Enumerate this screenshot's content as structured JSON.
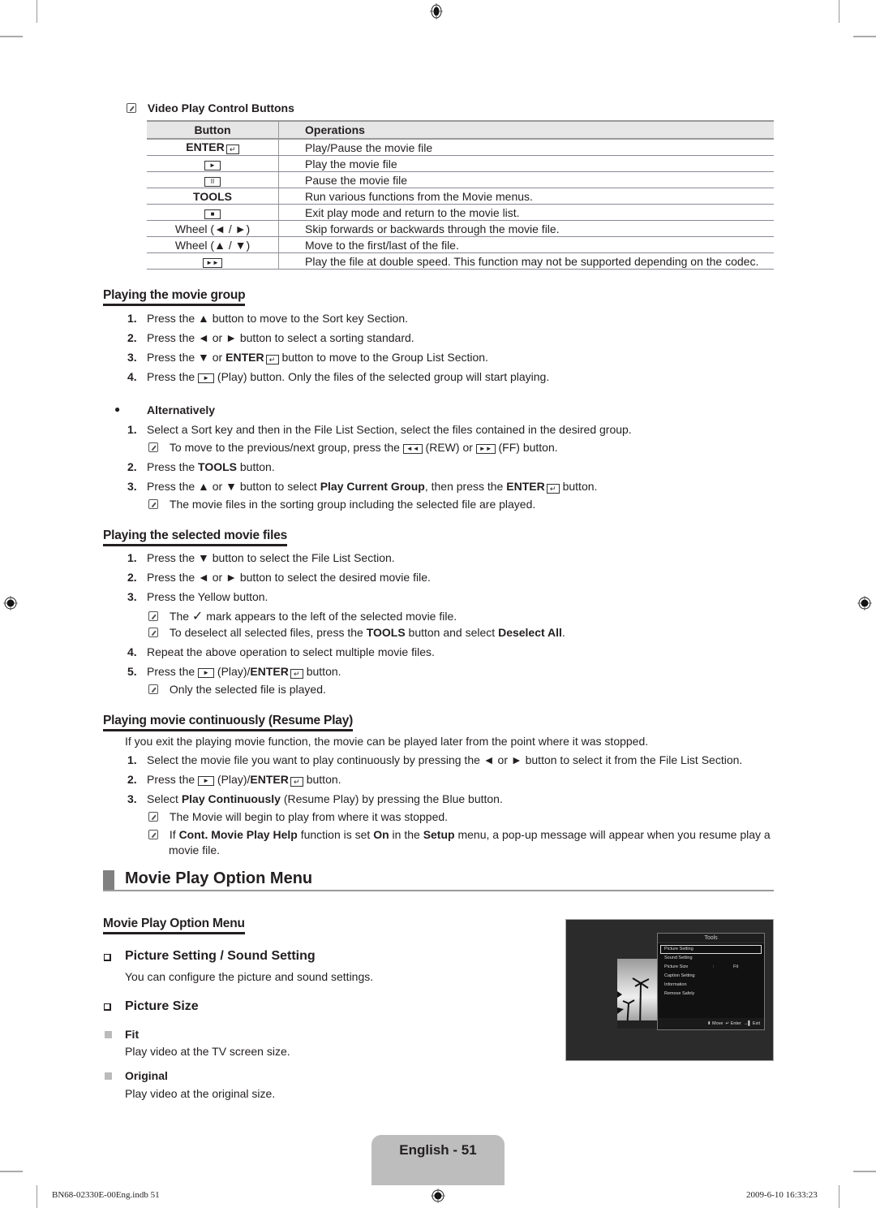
{
  "note_heading": "Video Play Control Buttons",
  "control_table": {
    "headers": [
      "Button",
      "Operations"
    ],
    "rows": [
      {
        "button": "ENTER",
        "button_type": "enter",
        "operation": "Play/Pause the movie file"
      },
      {
        "button": "►",
        "button_type": "box",
        "operation": "Play the movie file"
      },
      {
        "button": "II",
        "button_type": "box",
        "operation": "Pause the movie file"
      },
      {
        "button": "TOOLS",
        "button_type": "bold",
        "operation": "Run various functions from the Movie menus."
      },
      {
        "button": "■",
        "button_type": "box",
        "operation": "Exit play mode and return to the movie list."
      },
      {
        "button": "Wheel (◄ / ►)",
        "button_type": "text",
        "operation": "Skip forwards or backwards through the movie file."
      },
      {
        "button": "Wheel (▲ / ▼)",
        "button_type": "text",
        "operation": "Move to the first/last of the file."
      },
      {
        "button": "►►",
        "button_type": "box",
        "operation": "Play the file at double speed. This function may not be supported depending on the codec."
      }
    ]
  },
  "group_section": {
    "title": "Playing the movie group",
    "steps": [
      {
        "n": "1.",
        "parts": [
          "Press the ▲ button to move to the Sort key Section."
        ]
      },
      {
        "n": "2.",
        "parts": [
          "Press the ◄ or ► button to select a sorting standard."
        ]
      },
      {
        "n": "3.",
        "parts": [
          "Press the ▼ or ",
          "ENTER",
          " button to move to the Group List Section."
        ]
      },
      {
        "n": "4.",
        "parts": [
          "Press the ",
          "►",
          " (Play) button. Only the files of the selected group will start playing."
        ]
      }
    ],
    "alt_label": "Alternatively",
    "alt_steps": [
      {
        "n": "1.",
        "text": "Select a Sort key and then in the File List Section, select the files contained in the desired group."
      },
      {
        "n": "2.",
        "pre": "Press the ",
        "bold": "TOOLS",
        "post": " button."
      },
      {
        "n": "3.",
        "pre": "Press the ▲ or ▼ button to select ",
        "bold": "Play Current Group",
        "mid": ", then press the ",
        "bold2": "ENTER",
        "post": " button."
      }
    ],
    "alt_note1": {
      "pre": "To move to the previous/next group, press the ",
      "rew": "◄◄",
      "mid": " (REW) or ",
      "ff": "►►",
      "post": " (FF) button."
    },
    "alt_note2": "The movie files in the sorting group including the selected file are played."
  },
  "selected_section": {
    "title": "Playing the selected movie files",
    "step1": "Press the ▼ button to select the File List Section.",
    "step2": "Press the ◄ or ► button to select the desired movie file.",
    "step3": "Press the Yellow button.",
    "note1_pre": "The ",
    "note1_check": "✓",
    "note1_post": " mark appears to the left of the selected movie file.",
    "note2_pre": "To deselect all selected files, press the ",
    "note2_bold1": "TOOLS",
    "note2_mid": " button and select ",
    "note2_bold2": "Deselect All",
    "note2_post": ".",
    "step4": "Repeat the above operation to select multiple movie files.",
    "step5_pre": "Press the ",
    "step5_play": "►",
    "step5_mid": " (Play)/",
    "step5_bold": "ENTER",
    "step5_post": " button.",
    "note3": "Only the selected file is played."
  },
  "resume_section": {
    "title": "Playing movie continuously (Resume Play)",
    "intro": "If you exit the playing movie function, the movie can be played later from the point where it was stopped.",
    "step1": "Select the movie file you want to play continuously by pressing the ◄ or ► button to select it from the File List Section.",
    "step2_pre": "Press the ",
    "step2_play": "►",
    "step2_mid": " (Play)/",
    "step2_bold": "ENTER",
    "step2_post": " button.",
    "step3_pre": "Select ",
    "step3_bold": "Play Continuously",
    "step3_post": " (Resume Play) by pressing the Blue button.",
    "note1": "The Movie will begin to play from where it was stopped.",
    "note2_parts": [
      "If ",
      "Cont. Movie Play Help",
      " function is set ",
      "On",
      " in the ",
      "Setup",
      " menu, a pop-up message will appear when you resume play a"
    ],
    "note2_line2": "movie file."
  },
  "option_menu": {
    "section_title": "Movie Play Option Menu",
    "subtitle": "Movie Play Option Menu",
    "item1_title": "Picture Setting / Sound Setting",
    "item1_desc": "You can configure the picture and sound settings.",
    "item2_title": "Picture Size",
    "options": [
      {
        "label": "Fit",
        "desc": "Play video at the TV screen size."
      },
      {
        "label": "Original",
        "desc": "Play video at the original size."
      }
    ]
  },
  "tv_menu": {
    "title": "Tools",
    "items": [
      "Picture Setting",
      "Sound Setting",
      "Picture Size",
      "Caption Setting",
      "Information",
      "Remove Safely"
    ],
    "picture_size_value": "Fit",
    "colon": ":",
    "footer_move": "Move",
    "footer_enter": "Enter",
    "footer_exit": "Exit"
  },
  "page_label": "English - 51",
  "footer": {
    "file": "BN68-02330E-00Eng.indb   51",
    "datetime": "2009-6-10   16:33:23"
  }
}
